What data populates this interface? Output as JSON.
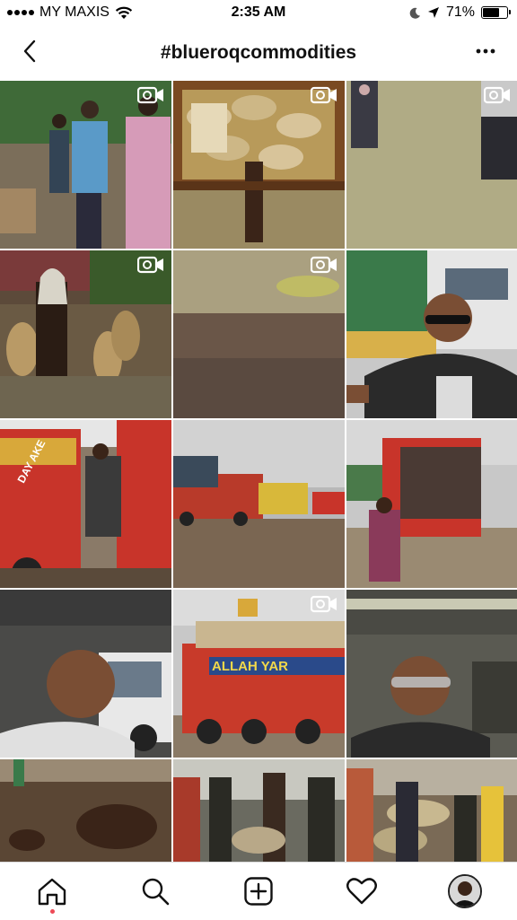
{
  "status_bar": {
    "carrier": "MY MAXIS",
    "time": "2:35 AM",
    "battery_percent": "71%",
    "battery_level": 0.71,
    "icons": [
      "signal-dots-icon",
      "wifi-icon",
      "moon-icon",
      "location-arrow-icon",
      "battery-icon"
    ]
  },
  "header": {
    "title": "#blueroqcommodities",
    "back_icon": "chevron-left-icon",
    "more_icon": "more-horizontal-icon"
  },
  "posts": [
    {
      "scene": "warehouse-people-counting",
      "is_video": true
    },
    {
      "scene": "truck-loading-sacks",
      "is_video": true
    },
    {
      "scene": "nuts-drying-ground-workers",
      "is_video": true
    },
    {
      "scene": "worker-carrying-sacks",
      "is_video": true
    },
    {
      "scene": "pile-of-cashew-nuts",
      "is_video": true
    },
    {
      "scene": "selfie-with-truck",
      "is_video": false
    },
    {
      "scene": "red-truck-loading",
      "is_video": false
    },
    {
      "scene": "trucks-in-yard",
      "is_video": false
    },
    {
      "scene": "loaded-truck-with-woman",
      "is_video": false
    },
    {
      "scene": "selfie-in-warehouse",
      "is_video": false
    },
    {
      "scene": "loaded-truck-allah-yar",
      "is_video": true
    },
    {
      "scene": "selfie-sunglasses-warehouse",
      "is_video": false
    },
    {
      "scene": "nuts-on-table",
      "is_video": false
    },
    {
      "scene": "workers-loading-truck",
      "is_video": false
    },
    {
      "scene": "workers-with-sacks",
      "is_video": false
    }
  ],
  "photo_text": {
    "truck_sign_1": "ALLAH YAR",
    "truck_sign_2": "DAY AKE"
  },
  "bottom_nav": [
    {
      "name": "home",
      "icon": "home-icon",
      "active": true
    },
    {
      "name": "search",
      "icon": "search-icon",
      "active": false
    },
    {
      "name": "new-post",
      "icon": "add-square-icon",
      "active": false
    },
    {
      "name": "activity",
      "icon": "heart-icon",
      "active": false
    },
    {
      "name": "profile",
      "icon": "profile-avatar-icon",
      "active": false
    }
  ],
  "colors": {
    "accent_dot": "#ed4956",
    "text": "#111111",
    "divider": "#dbdbdb"
  }
}
